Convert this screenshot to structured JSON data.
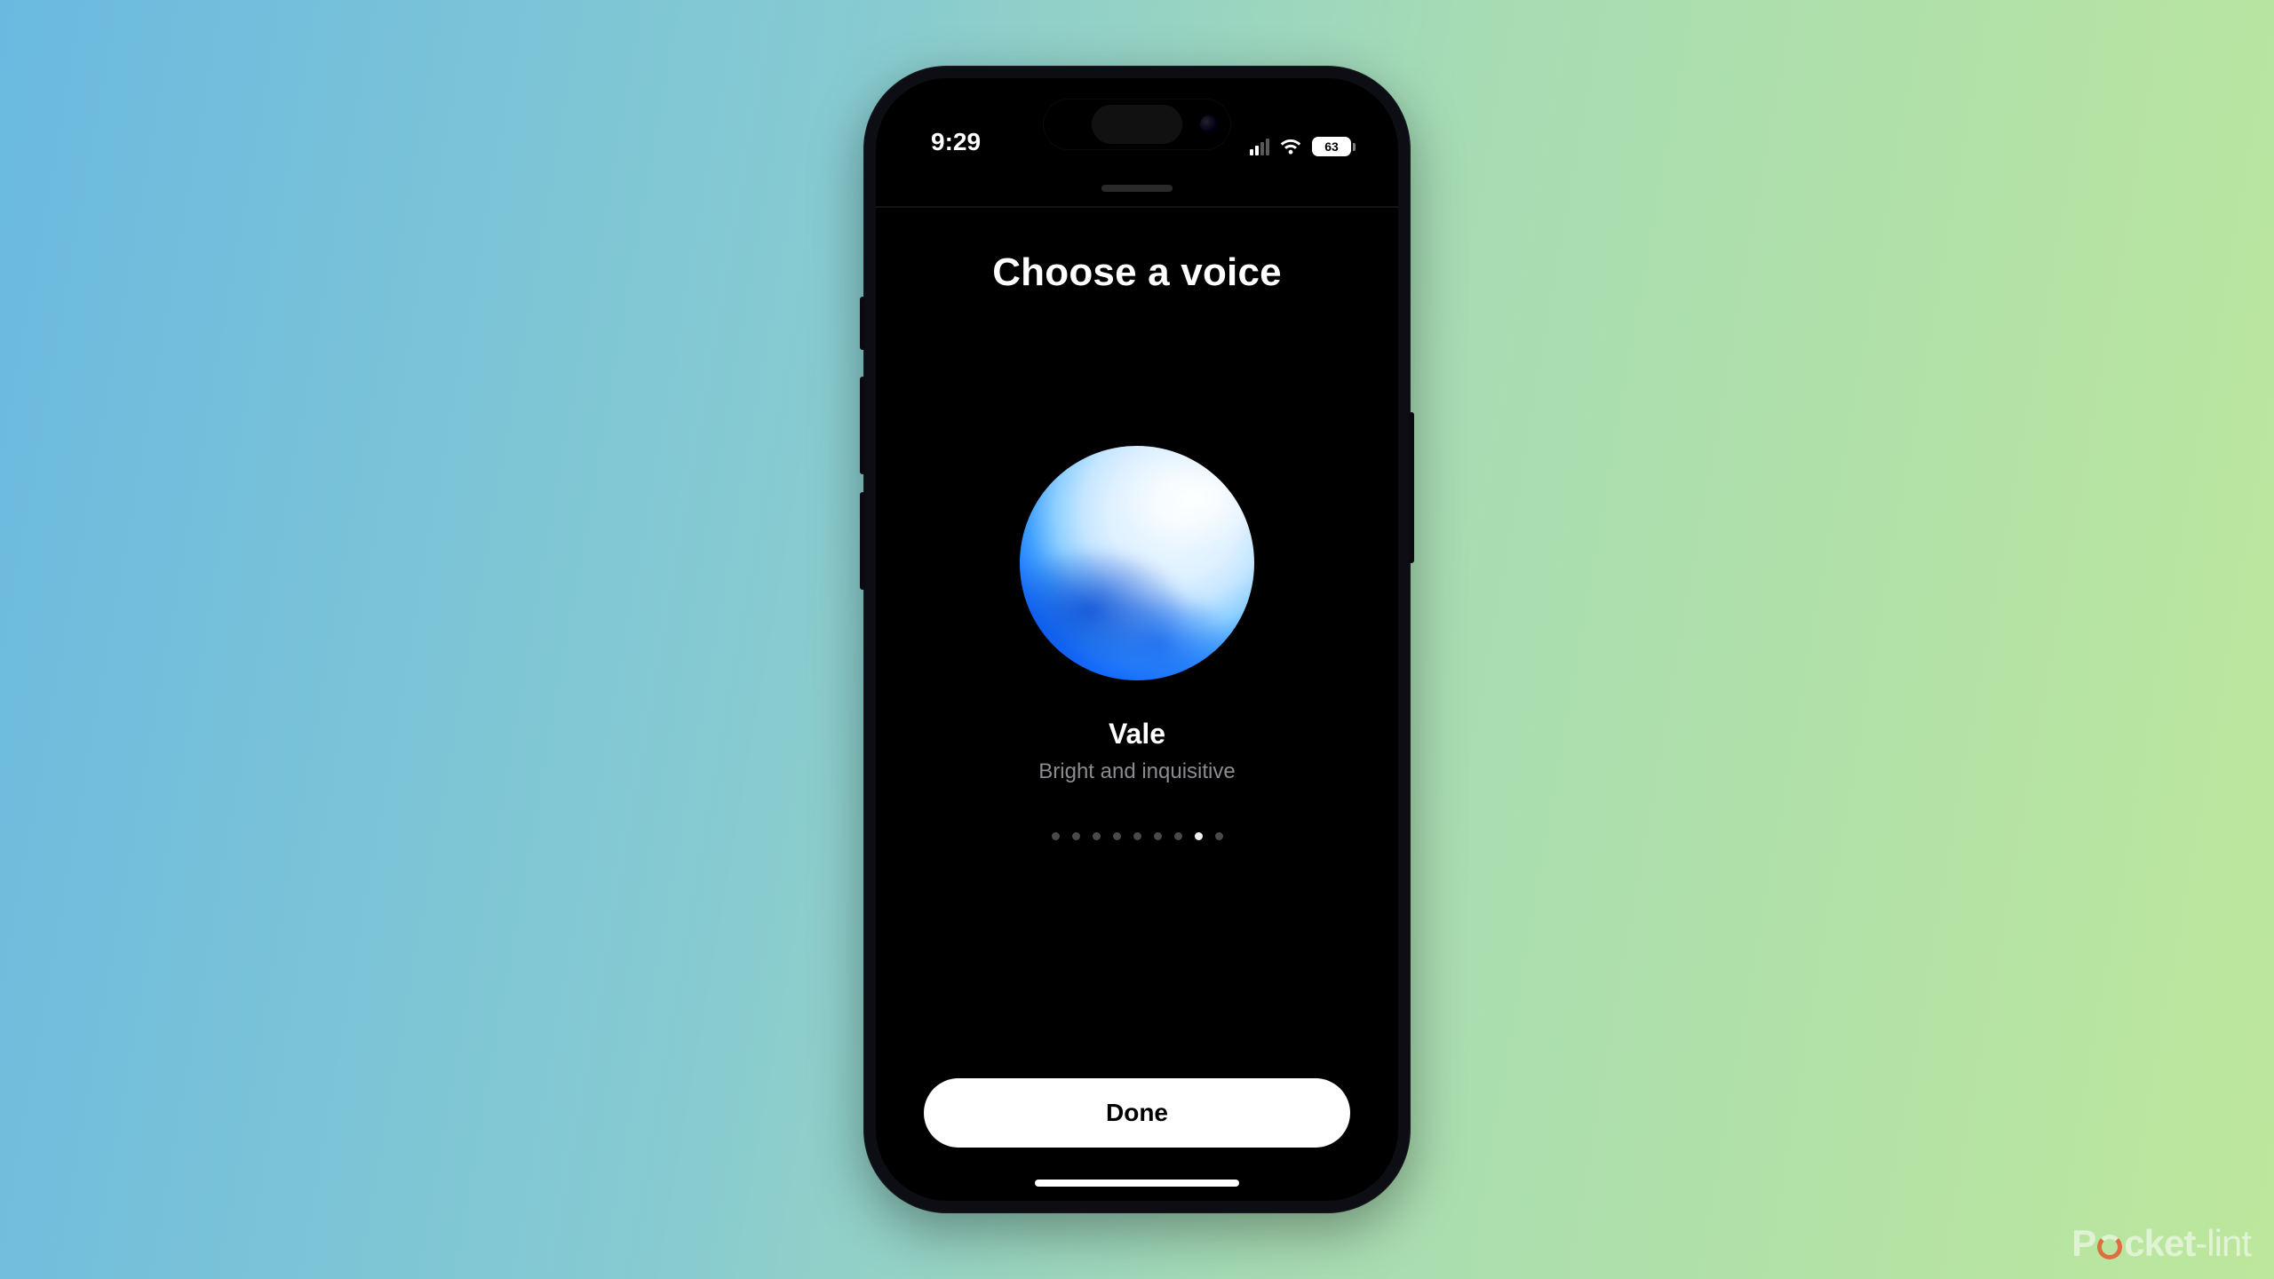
{
  "statusbar": {
    "time": "9:29",
    "battery_level": "63",
    "signal_bars_active": 2,
    "signal_bars_total": 4
  },
  "screen": {
    "title": "Choose a voice",
    "voice_name": "Vale",
    "voice_description": "Bright and inquisitive",
    "done_label": "Done"
  },
  "pager": {
    "count": 9,
    "active_index": 7
  },
  "watermark": {
    "brand_p": "P",
    "brand_rest": "cket",
    "brand_suffix": "-lint"
  }
}
